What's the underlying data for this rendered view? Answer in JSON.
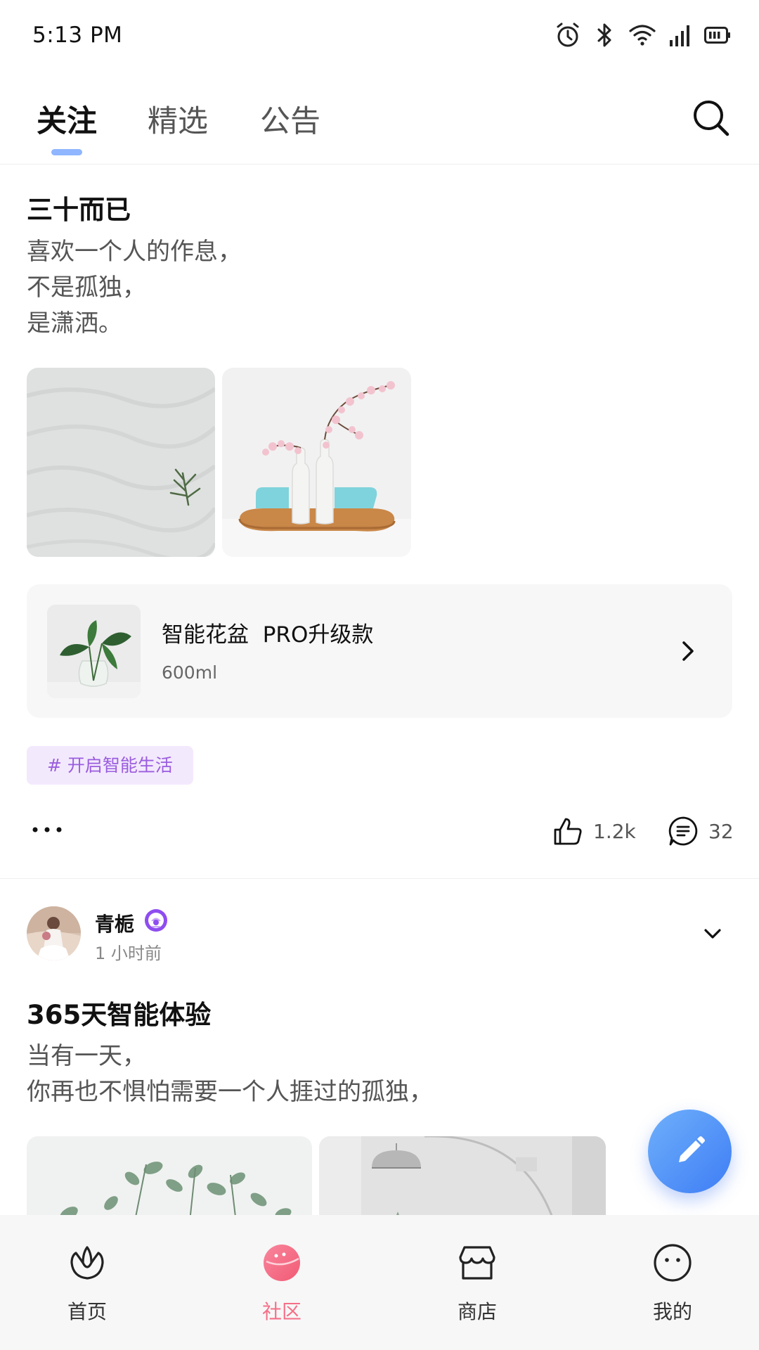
{
  "status_bar": {
    "time": "5:13 PM",
    "icons": [
      "alarm-icon",
      "bluetooth-icon",
      "wifi-icon",
      "signal-icon",
      "battery-icon"
    ]
  },
  "tabs": {
    "items": [
      {
        "label": "关注",
        "active": true
      },
      {
        "label": "精选",
        "active": false
      },
      {
        "label": "公告",
        "active": false
      }
    ],
    "search_icon": "search-icon",
    "indicator_color": "#8fb6ff"
  },
  "post1": {
    "title": "三十而已",
    "body": [
      "喜欢一个人的作息，",
      "不是孤独，",
      "是潇洒。"
    ],
    "images": [
      "sand-dune-plant-photo",
      "cherry-blossom-vases-photo"
    ],
    "product": {
      "name": "智能花盆  PRO升级款",
      "volume": "600ml"
    },
    "tag": "# 开启智能生活",
    "likes": "1.2k",
    "comments": "32"
  },
  "post2": {
    "author": "青栀",
    "time": "1 小时前",
    "title": "365天智能体验",
    "body": [
      "当有一天，",
      "你再也不惧怕需要一个人捱过的孤独，"
    ],
    "images": [
      "eucalyptus-photo",
      "lamp-room-photo"
    ]
  },
  "fab": {
    "icon": "pencil-icon"
  },
  "bottom_nav": {
    "items": [
      {
        "label": "首页",
        "icon": "tulip-icon",
        "active": false
      },
      {
        "label": "社区",
        "icon": "planet-icon",
        "active": true
      },
      {
        "label": "商店",
        "icon": "store-icon",
        "active": false
      },
      {
        "label": "我的",
        "icon": "face-icon",
        "active": false
      }
    ],
    "active_color": "#f56e87"
  },
  "colors": {
    "tag_bg": "#f3e9fd",
    "tag_text": "#9a5dde",
    "fab_gradient": [
      "#6fb0fb",
      "#3e7df5"
    ]
  }
}
